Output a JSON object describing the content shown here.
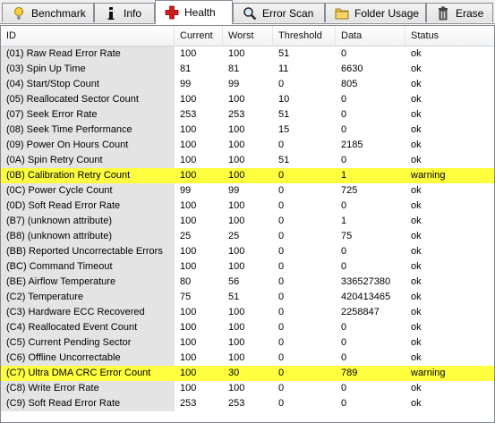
{
  "tabs": [
    {
      "label": "Benchmark",
      "icon": "lightbulb-icon",
      "active": false
    },
    {
      "label": "Info",
      "icon": "info-icon",
      "active": false
    },
    {
      "label": "Health",
      "icon": "red-cross-icon",
      "active": true
    },
    {
      "label": "Error Scan",
      "icon": "magnifier-icon",
      "active": false
    },
    {
      "label": "Folder Usage",
      "icon": "folder-icon",
      "active": false
    },
    {
      "label": "Erase",
      "icon": "trash-icon",
      "active": false
    }
  ],
  "columns": {
    "id": "ID",
    "current": "Current",
    "worst": "Worst",
    "threshold": "Threshold",
    "data": "Data",
    "status": "Status"
  },
  "colors": {
    "warning_highlight": "#ffff40",
    "health_cross": "#d01c1c"
  },
  "rows": [
    {
      "id": "(01) Raw Read Error Rate",
      "current": "100",
      "worst": "100",
      "threshold": "51",
      "data": "0",
      "status": "ok"
    },
    {
      "id": "(03) Spin Up Time",
      "current": "81",
      "worst": "81",
      "threshold": "11",
      "data": "6630",
      "status": "ok"
    },
    {
      "id": "(04) Start/Stop Count",
      "current": "99",
      "worst": "99",
      "threshold": "0",
      "data": "805",
      "status": "ok"
    },
    {
      "id": "(05) Reallocated Sector Count",
      "current": "100",
      "worst": "100",
      "threshold": "10",
      "data": "0",
      "status": "ok"
    },
    {
      "id": "(07) Seek Error Rate",
      "current": "253",
      "worst": "253",
      "threshold": "51",
      "data": "0",
      "status": "ok"
    },
    {
      "id": "(08) Seek Time Performance",
      "current": "100",
      "worst": "100",
      "threshold": "15",
      "data": "0",
      "status": "ok"
    },
    {
      "id": "(09) Power On Hours Count",
      "current": "100",
      "worst": "100",
      "threshold": "0",
      "data": "2185",
      "status": "ok"
    },
    {
      "id": "(0A) Spin Retry Count",
      "current": "100",
      "worst": "100",
      "threshold": "51",
      "data": "0",
      "status": "ok"
    },
    {
      "id": "(0B) Calibration Retry Count",
      "current": "100",
      "worst": "100",
      "threshold": "0",
      "data": "1",
      "status": "warning"
    },
    {
      "id": "(0C) Power Cycle Count",
      "current": "99",
      "worst": "99",
      "threshold": "0",
      "data": "725",
      "status": "ok"
    },
    {
      "id": "(0D) Soft Read Error Rate",
      "current": "100",
      "worst": "100",
      "threshold": "0",
      "data": "0",
      "status": "ok"
    },
    {
      "id": "(B7) (unknown attribute)",
      "current": "100",
      "worst": "100",
      "threshold": "0",
      "data": "1",
      "status": "ok"
    },
    {
      "id": "(B8) (unknown attribute)",
      "current": "25",
      "worst": "25",
      "threshold": "0",
      "data": "75",
      "status": "ok"
    },
    {
      "id": "(BB) Reported Uncorrectable Errors",
      "current": "100",
      "worst": "100",
      "threshold": "0",
      "data": "0",
      "status": "ok"
    },
    {
      "id": "(BC) Command Timeout",
      "current": "100",
      "worst": "100",
      "threshold": "0",
      "data": "0",
      "status": "ok"
    },
    {
      "id": "(BE) Airflow Temperature",
      "current": "80",
      "worst": "56",
      "threshold": "0",
      "data": "336527380",
      "status": "ok"
    },
    {
      "id": "(C2) Temperature",
      "current": "75",
      "worst": "51",
      "threshold": "0",
      "data": "420413465",
      "status": "ok"
    },
    {
      "id": "(C3) Hardware ECC Recovered",
      "current": "100",
      "worst": "100",
      "threshold": "0",
      "data": "2258847",
      "status": "ok"
    },
    {
      "id": "(C4) Reallocated Event Count",
      "current": "100",
      "worst": "100",
      "threshold": "0",
      "data": "0",
      "status": "ok"
    },
    {
      "id": "(C5) Current Pending Sector",
      "current": "100",
      "worst": "100",
      "threshold": "0",
      "data": "0",
      "status": "ok"
    },
    {
      "id": "(C6) Offline Uncorrectable",
      "current": "100",
      "worst": "100",
      "threshold": "0",
      "data": "0",
      "status": "ok"
    },
    {
      "id": "(C7) Ultra DMA CRC Error Count",
      "current": "100",
      "worst": "30",
      "threshold": "0",
      "data": "789",
      "status": "warning"
    },
    {
      "id": "(C8) Write Error Rate",
      "current": "100",
      "worst": "100",
      "threshold": "0",
      "data": "0",
      "status": "ok"
    },
    {
      "id": "(C9) Soft Read Error Rate",
      "current": "253",
      "worst": "253",
      "threshold": "0",
      "data": "0",
      "status": "ok"
    }
  ]
}
